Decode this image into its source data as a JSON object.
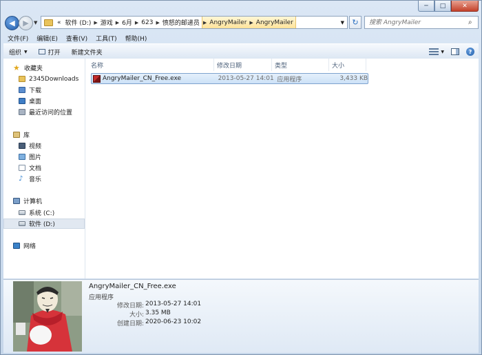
{
  "caption": {
    "min": "─",
    "max": "□",
    "close": "✕"
  },
  "nav": {
    "back": "◀",
    "forward": "▶",
    "history": "▼"
  },
  "address": {
    "overflow": "«",
    "segments": [
      "软件 (D:)",
      "游戏",
      "6月",
      "623",
      "愤怒的邮递员",
      "AngryMailer",
      "AngryMailer"
    ],
    "dropdown": "▼"
  },
  "refresh": "↻",
  "search": {
    "placeholder": "搜索 AngryMailer",
    "icon": "⌕"
  },
  "menu": [
    "文件(F)",
    "编辑(E)",
    "查看(V)",
    "工具(T)",
    "帮助(H)"
  ],
  "toolbar": {
    "organize": "组织",
    "open": "打开",
    "new_folder": "新建文件夹",
    "help": "?"
  },
  "sidebar": {
    "favorites": "收藏夹",
    "fav_items": [
      "2345Downloads",
      "下载",
      "桌面",
      "最近访问的位置"
    ],
    "libraries": "库",
    "lib_items": [
      "视频",
      "图片",
      "文档",
      "音乐"
    ],
    "computer": "计算机",
    "drives": [
      "系统 (C:)",
      "软件 (D:)"
    ],
    "network": "网络"
  },
  "columns": {
    "name": "名称",
    "date": "修改日期",
    "type": "类型",
    "size": "大小"
  },
  "files": [
    {
      "name": "AngryMailer_CN_Free.exe",
      "date": "2013-05-27 14:01",
      "type": "应用程序",
      "size": "3,433 KB"
    }
  ],
  "details": {
    "name": "AngryMailer_CN_Free.exe",
    "type": "应用程序",
    "modified_label": "修改日期:",
    "modified": "2013-05-27 14:01",
    "size_label": "大小:",
    "size": "3.35 MB",
    "created_label": "创建日期:",
    "created": "2020-06-23 10:02"
  }
}
